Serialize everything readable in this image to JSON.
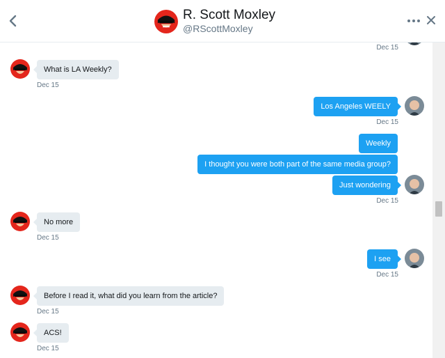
{
  "header": {
    "name": "R. Scott Moxley",
    "handle": "@RScottMoxley"
  },
  "messages": [
    {
      "text": "What is LA Weekly?",
      "timestamp": "Dec 15",
      "direction": "received"
    },
    {
      "text": "Los Angeles WEELY",
      "timestamp": "Dec 15",
      "direction": "sent"
    },
    {
      "text": "Weekly",
      "direction": "sent"
    },
    {
      "text": "I thought you were both part of the same media group?",
      "direction": "sent"
    },
    {
      "text": "Just wondering",
      "timestamp": "Dec 15",
      "direction": "sent"
    },
    {
      "text": "No more",
      "timestamp": "Dec 15",
      "direction": "received"
    },
    {
      "text": "I see",
      "timestamp": "Dec 15",
      "direction": "sent"
    },
    {
      "text": "Before I read it, what did you learn from the article?",
      "timestamp": "Dec 15",
      "direction": "received"
    },
    {
      "text": "ACS!",
      "timestamp": "Dec 15",
      "direction": "received"
    }
  ],
  "top_timestamp": "Dec 15",
  "colors": {
    "sent_bubble": "#1da1f2",
    "received_bubble": "#e6ecf0",
    "muted_text": "#657786"
  },
  "icons": {
    "back": "chevron-left-icon",
    "more": "more-dots-icon",
    "close": "close-icon"
  }
}
